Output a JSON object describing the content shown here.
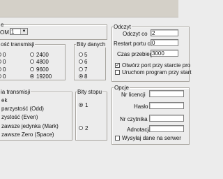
{
  "port_group": {
    "legend": "e",
    "port_label": "OM",
    "port_value": "1"
  },
  "speed_group": {
    "legend": "ość transmisji",
    "options": [
      {
        "label": "0",
        "selected": false
      },
      {
        "label": "2400",
        "selected": false
      },
      {
        "label": "0",
        "selected": false
      },
      {
        "label": "4800",
        "selected": false
      },
      {
        "label": "0",
        "selected": false
      },
      {
        "label": "9600",
        "selected": false
      },
      {
        "label": "0",
        "selected": false
      },
      {
        "label": "19200",
        "selected": true
      }
    ]
  },
  "data_bits_group": {
    "legend": "Bity danych",
    "options": [
      {
        "label": "5",
        "selected": false
      },
      {
        "label": "6",
        "selected": false
      },
      {
        "label": "7",
        "selected": false
      },
      {
        "label": "8",
        "selected": true
      }
    ]
  },
  "parity_group": {
    "legend": "ia transmisji",
    "options": [
      {
        "label": "ek"
      },
      {
        "label": "parzystość (Odd)"
      },
      {
        "label": "zystość (Even)"
      },
      {
        "label": "zawsze jedynka (Mark)"
      },
      {
        "label": "zawsze Zero (Space)"
      }
    ]
  },
  "stop_bits_group": {
    "legend": "Bity stopu",
    "options": [
      {
        "label": "1",
        "selected": true
      },
      {
        "label": "2",
        "selected": false
      }
    ]
  },
  "read_group": {
    "legend": "Odczyt",
    "rows": [
      {
        "label": "Odczyt co",
        "value": "2"
      },
      {
        "label": "Restart portu co",
        "value": "0"
      },
      {
        "label": "Czas przebiegu",
        "value": "3000"
      }
    ],
    "checks": [
      {
        "label": "Otwórz port przy starcie pro",
        "checked": true
      },
      {
        "label": "Uruchom program przy start",
        "checked": false
      }
    ]
  },
  "options_group": {
    "legend": "Opcje",
    "fields": [
      {
        "label": "Nr licencji",
        "value": ""
      },
      {
        "label": "Hasło",
        "value": ""
      },
      {
        "label": "Nr czytnika",
        "value": ""
      },
      {
        "label": "Adnotacja",
        "value": ""
      }
    ],
    "check": {
      "label": "Wysyłaj dane na serwer",
      "checked": false
    }
  }
}
